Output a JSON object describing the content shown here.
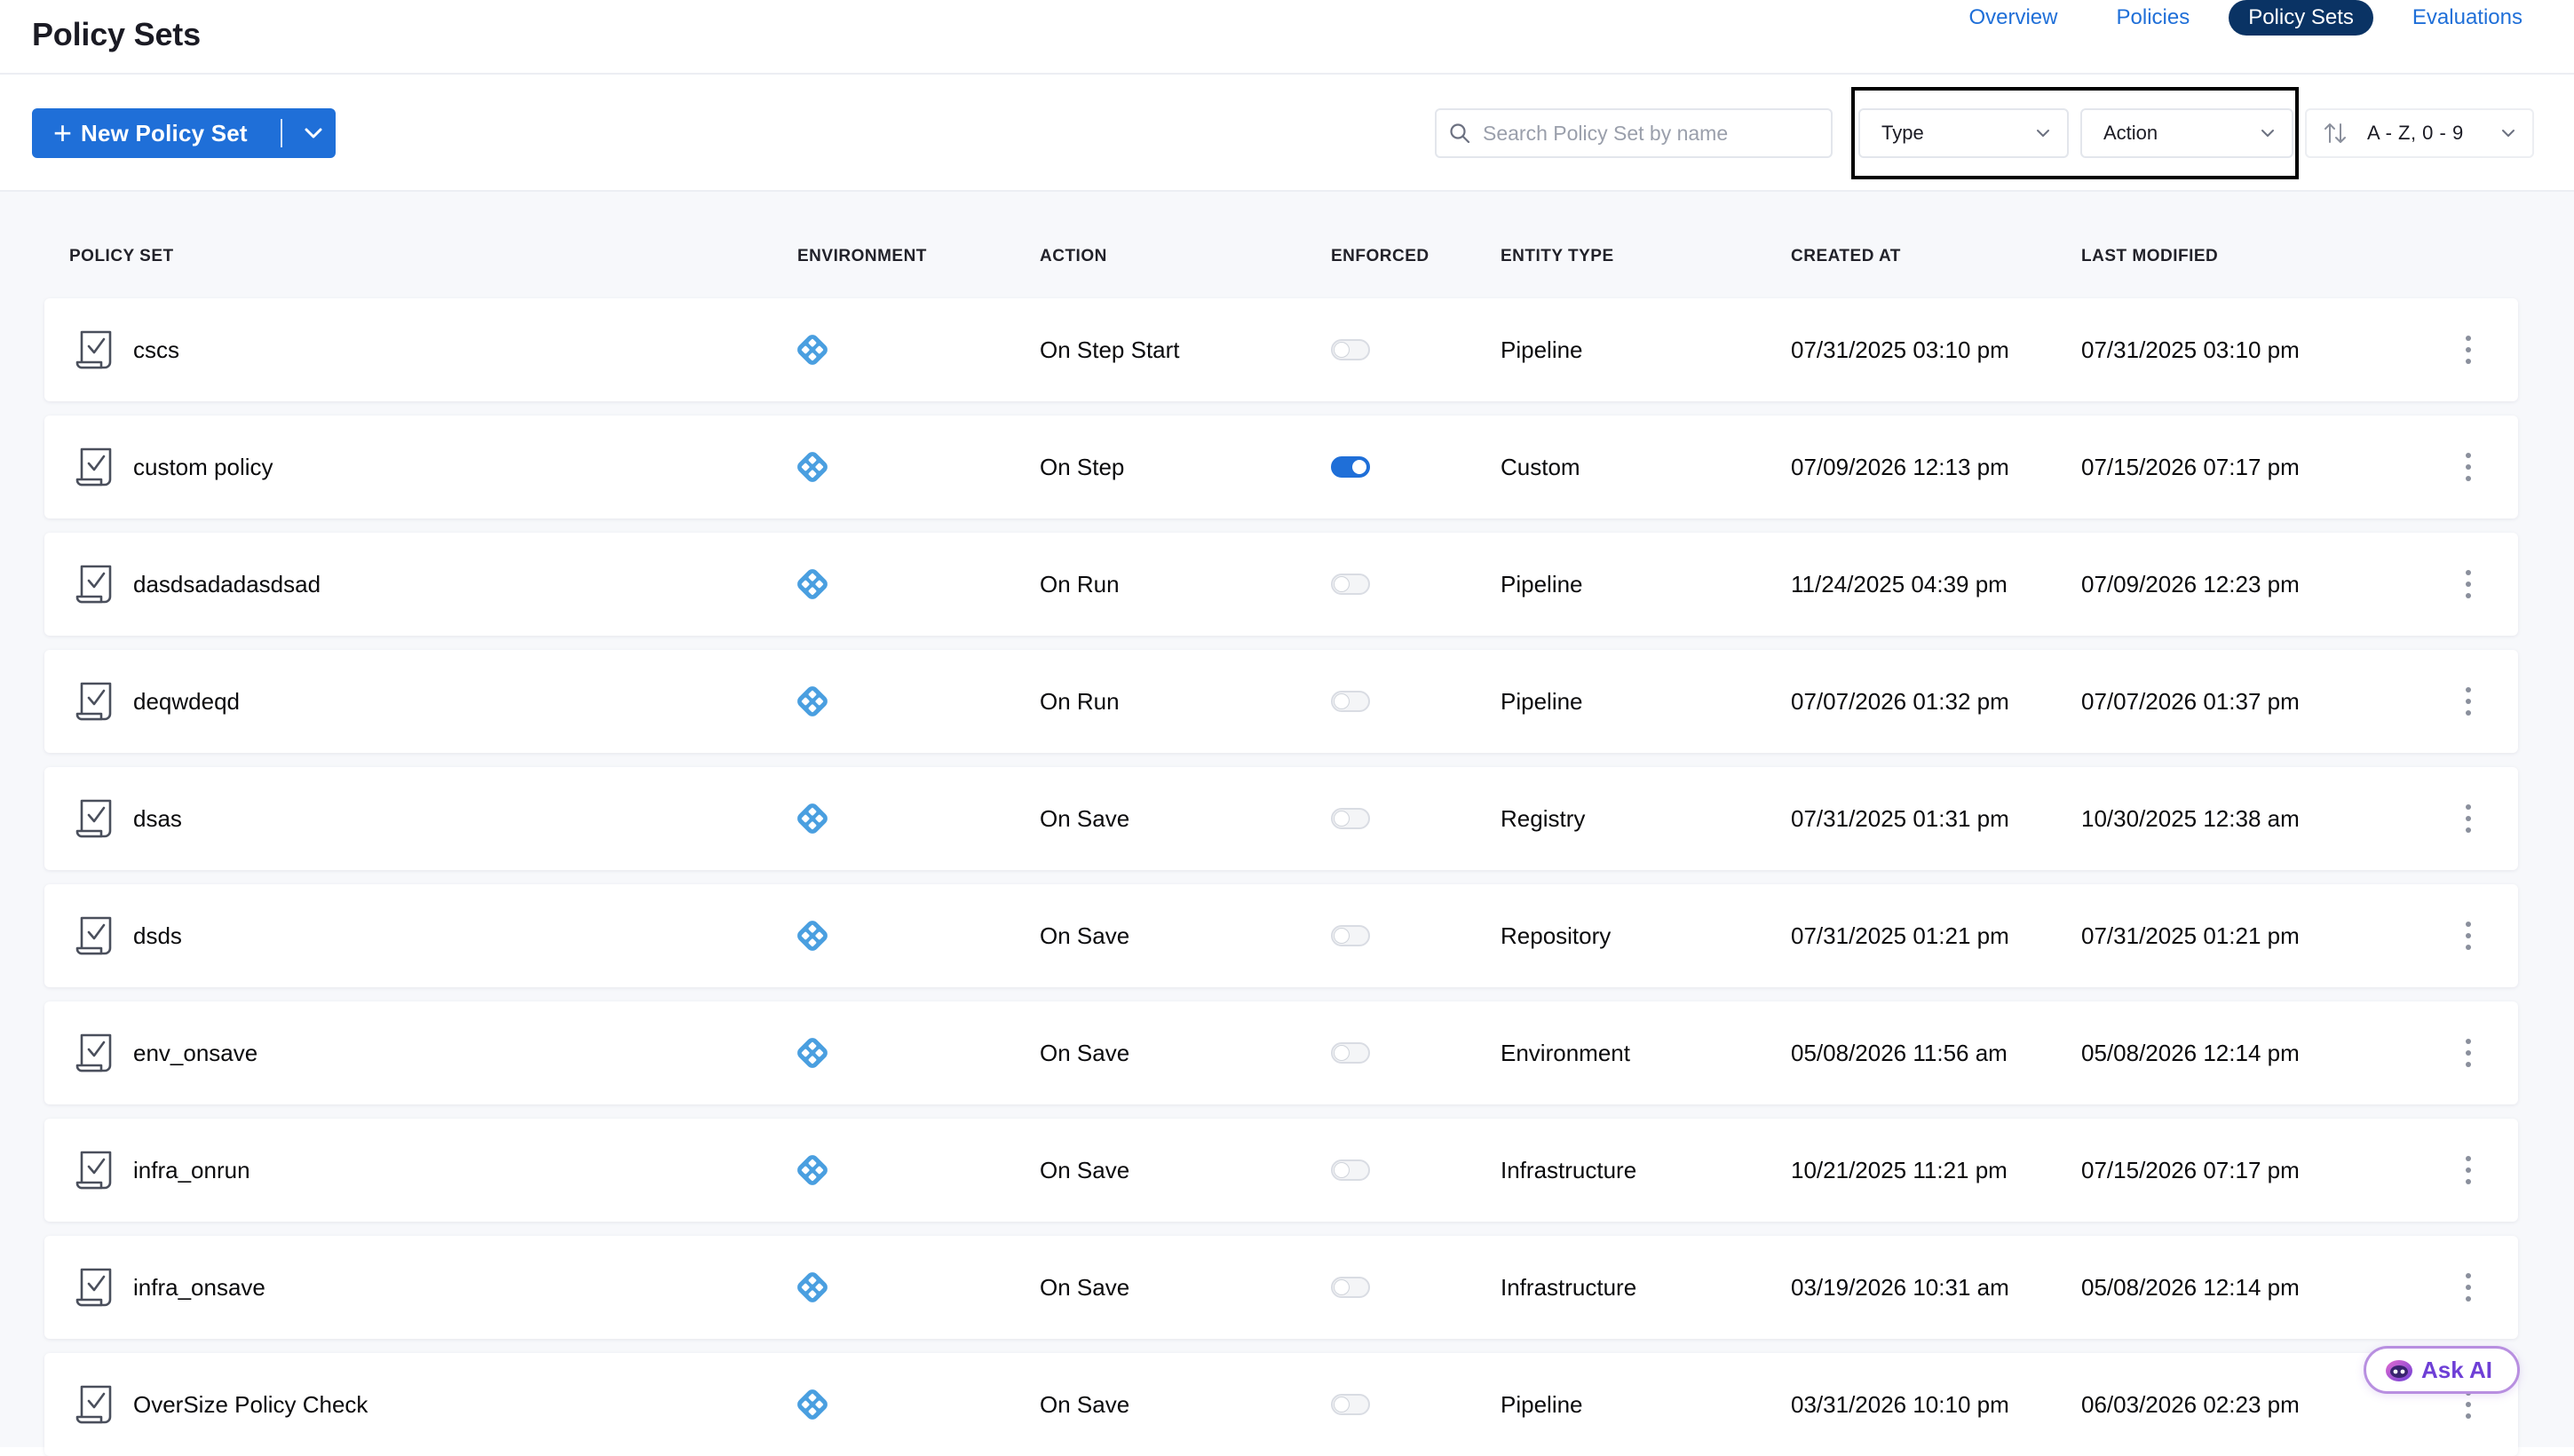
{
  "header": {
    "title": "Policy Sets",
    "tabs": [
      {
        "label": "Overview",
        "active": false
      },
      {
        "label": "Policies",
        "active": false
      },
      {
        "label": "Policy Sets",
        "active": true
      },
      {
        "label": "Evaluations",
        "active": false
      }
    ]
  },
  "toolbar": {
    "new_button_label": "New Policy Set",
    "search_placeholder": "Search Policy Set by name",
    "type_filter": "Type",
    "action_filter": "Action",
    "sort_label": "A - Z, 0 - 9"
  },
  "table": {
    "columns": [
      "POLICY SET",
      "ENVIRONMENT",
      "ACTION",
      "ENFORCED",
      "ENTITY TYPE",
      "CREATED AT",
      "LAST MODIFIED"
    ],
    "rows": [
      {
        "name": "cscs",
        "action": "On Step Start",
        "enforced": false,
        "entity_type": "Pipeline",
        "created": "07/31/2025 03:10 pm",
        "modified": "07/31/2025 03:10 pm"
      },
      {
        "name": "custom policy",
        "action": "On Step",
        "enforced": true,
        "entity_type": "Custom",
        "created": "07/09/2026 12:13 pm",
        "modified": "07/15/2026 07:17 pm"
      },
      {
        "name": "dasdsadadasdsad",
        "action": "On Run",
        "enforced": false,
        "entity_type": "Pipeline",
        "created": "11/24/2025 04:39 pm",
        "modified": "07/09/2026 12:23 pm"
      },
      {
        "name": "deqwdeqd",
        "action": "On Run",
        "enforced": false,
        "entity_type": "Pipeline",
        "created": "07/07/2026 01:32 pm",
        "modified": "07/07/2026 01:37 pm"
      },
      {
        "name": "dsas",
        "action": "On Save",
        "enforced": false,
        "entity_type": "Registry",
        "created": "07/31/2025 01:31 pm",
        "modified": "10/30/2025 12:38 am"
      },
      {
        "name": "dsds",
        "action": "On Save",
        "enforced": false,
        "entity_type": "Repository",
        "created": "07/31/2025 01:21 pm",
        "modified": "07/31/2025 01:21 pm"
      },
      {
        "name": "env_onsave",
        "action": "On Save",
        "enforced": false,
        "entity_type": "Environment",
        "created": "05/08/2026 11:56 am",
        "modified": "05/08/2026 12:14 pm"
      },
      {
        "name": "infra_onrun",
        "action": "On Save",
        "enforced": false,
        "entity_type": "Infrastructure",
        "created": "10/21/2025 11:21 pm",
        "modified": "07/15/2026 07:17 pm"
      },
      {
        "name": "infra_onsave",
        "action": "On Save",
        "enforced": false,
        "entity_type": "Infrastructure",
        "created": "03/19/2026 10:31 am",
        "modified": "05/08/2026 12:14 pm"
      },
      {
        "name": "OverSize Policy Check",
        "action": "On Save",
        "enforced": false,
        "entity_type": "Pipeline",
        "created": "03/31/2026 10:10 pm",
        "modified": "06/03/2026 02:23 pm"
      }
    ]
  },
  "ask_ai": {
    "label": "Ask AI"
  },
  "icons": {
    "policy_set_row": "policy-document-check-icon",
    "environment": "project-scope-icon",
    "more": "more-vertical-icon"
  },
  "colors": {
    "primary": "#1f6fd8",
    "active_tab_bg": "#0a3364",
    "environment_icon": "#4a9fe0",
    "ask_ai_accent": "#6e3fd6"
  }
}
